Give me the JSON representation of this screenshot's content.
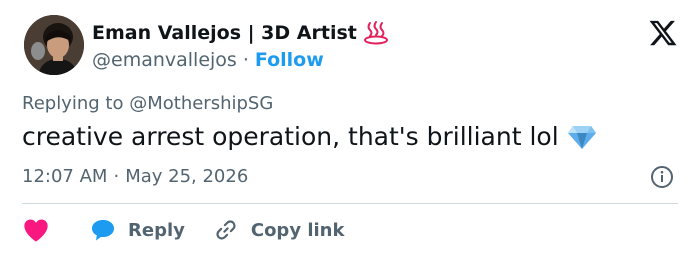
{
  "author": {
    "display_name": "Eman Vallejos | 3D Artist",
    "handle": "@emanvallejos",
    "separator": "·",
    "follow_label": "Follow"
  },
  "tweet": {
    "replying_prefix": "Replying to",
    "replying_to": "@MothershipSG",
    "text": "creative arrest operation, that's brilliant lol",
    "time": "12:07 AM",
    "date": "May 25, 2026",
    "separator": "·"
  },
  "actions": {
    "reply_label": "Reply",
    "copy_link_label": "Copy link"
  },
  "colors": {
    "accent": "#1d9bf0",
    "like": "#f91880",
    "secondary_text": "#536471",
    "primary_text": "#0f1419",
    "divider": "#cfd9de"
  },
  "icons": {
    "name_emoji": "hot-springs-icon",
    "text_emoji": "gem-icon",
    "brand": "x-logo-icon",
    "info": "info-icon",
    "like": "heart-icon",
    "reply": "reply-bubble-icon",
    "copy_link": "link-icon"
  }
}
